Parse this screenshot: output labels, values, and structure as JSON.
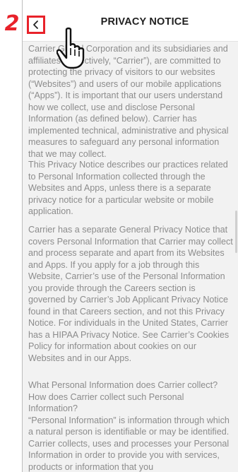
{
  "annotation": {
    "step_number": "2"
  },
  "header": {
    "title": "PRIVACY NOTICE",
    "back_icon": "chevron-left-icon"
  },
  "overlay": {
    "cursor_icon": "hand-pointer-icon"
  },
  "content": {
    "paragraphs": [
      "Carrier Global Corporation and its subsidiaries and affiliates (collectively, “Carrier”), are committed to protecting the privacy of visitors to our websites (“Websites”) and users of our mobile applications (“Apps”). It is important that our users understand how we collect, use and disclose Personal Information (as defined below). Carrier has implemented technical, administrative and physical measures to safeguard any personal information that we may collect.",
      "This Privacy Notice describes our practices related to Personal Information collected through the Websites and Apps, unless there is a separate privacy notice for a particular website or mobile application.",
      "Carrier has a separate General Privacy Notice that covers Personal Information that Carrier may collect and process separate and apart from its Websites and Apps. If you apply for a job through this Website, Carrier’s use of the Personal Information you provide through the Careers section is governed by Carrier’s Job Applicant Privacy Notice found in that Careers section, and not this Privacy Notice. For individuals in the United States, Carrier has a HIPAA Privacy Notice. See Carrier’s Cookies Policy for information about cookies on our Websites and in our Apps.",
      "What Personal Information does Carrier collect? How does Carrier collect such Personal Information?\n“Personal Information” is information through which a natural person is identifiable or may be identified. Carrier collects, uses and processes your Personal Information in order to provide you with services, products or information that you"
    ]
  },
  "colors": {
    "annotation_red": "#e8222a",
    "body_text": "#8c8c8c",
    "title_text": "#1f1f1f",
    "background": "#f2f2f2"
  }
}
